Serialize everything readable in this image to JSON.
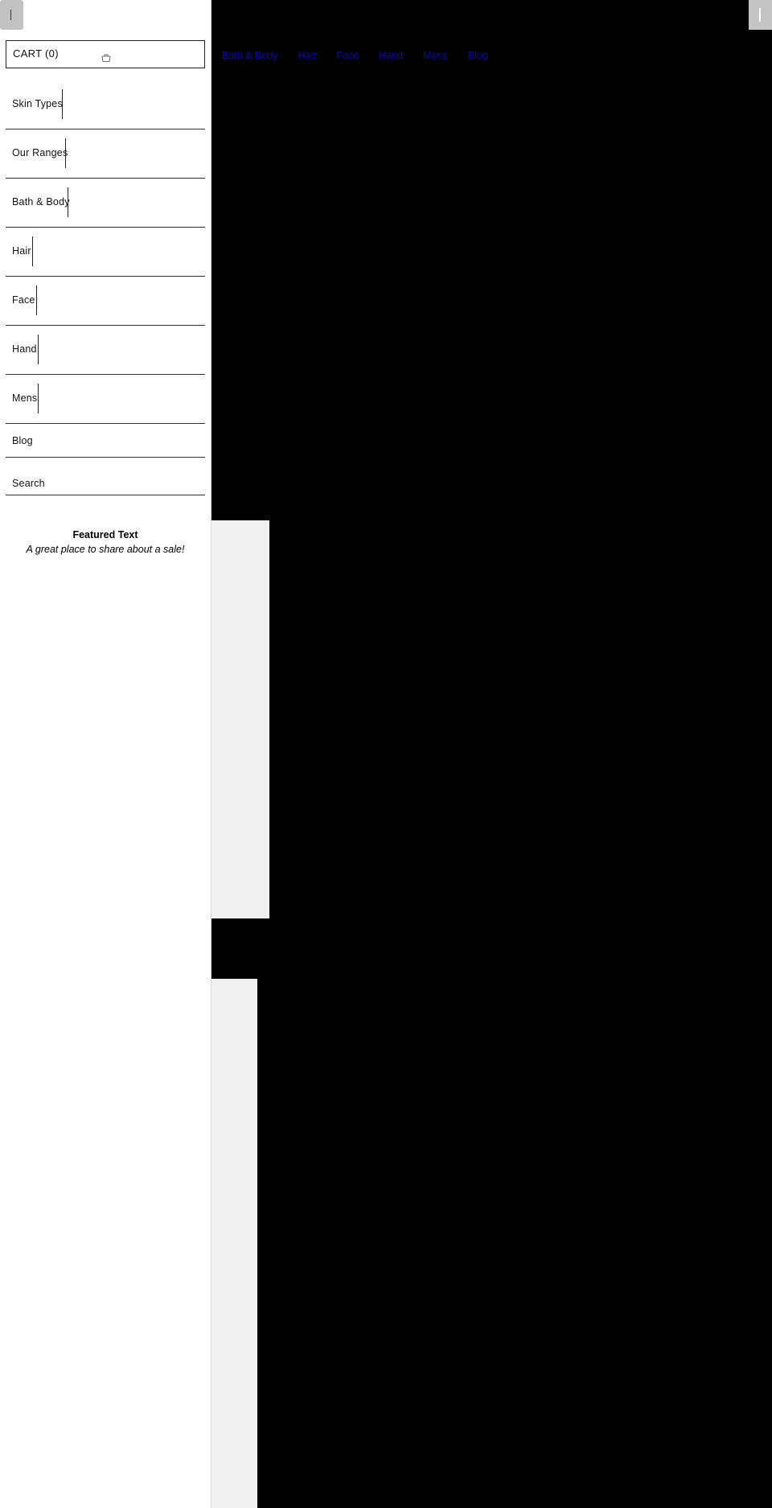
{
  "sidebar": {
    "cart_label": "CART (0)",
    "nav_items": [
      {
        "label": "Skin Types"
      },
      {
        "label": "Our Ranges"
      },
      {
        "label": "Bath & Body"
      },
      {
        "label": "Hair"
      },
      {
        "label": "Face"
      },
      {
        "label": "Hand"
      },
      {
        "label": "Mens"
      },
      {
        "label": "Blog"
      }
    ],
    "search_label": "Search",
    "featured": {
      "title": "Featured Text",
      "subtitle": "A great place to share about a sale!"
    }
  },
  "topnav": {
    "links": [
      {
        "label": "Bath & Body"
      },
      {
        "label": "Hair"
      },
      {
        "label": "Face"
      },
      {
        "label": "Hand"
      },
      {
        "label": "Mens"
      },
      {
        "label": "Blog"
      }
    ]
  },
  "icons": {
    "cart": "shopping-bag-icon",
    "menu_toggle": "toggle-icon"
  },
  "colors": {
    "link": "#0a0aa0",
    "background": "#000000",
    "sidebar": "#ffffff",
    "panel": "#f0f0f0"
  }
}
